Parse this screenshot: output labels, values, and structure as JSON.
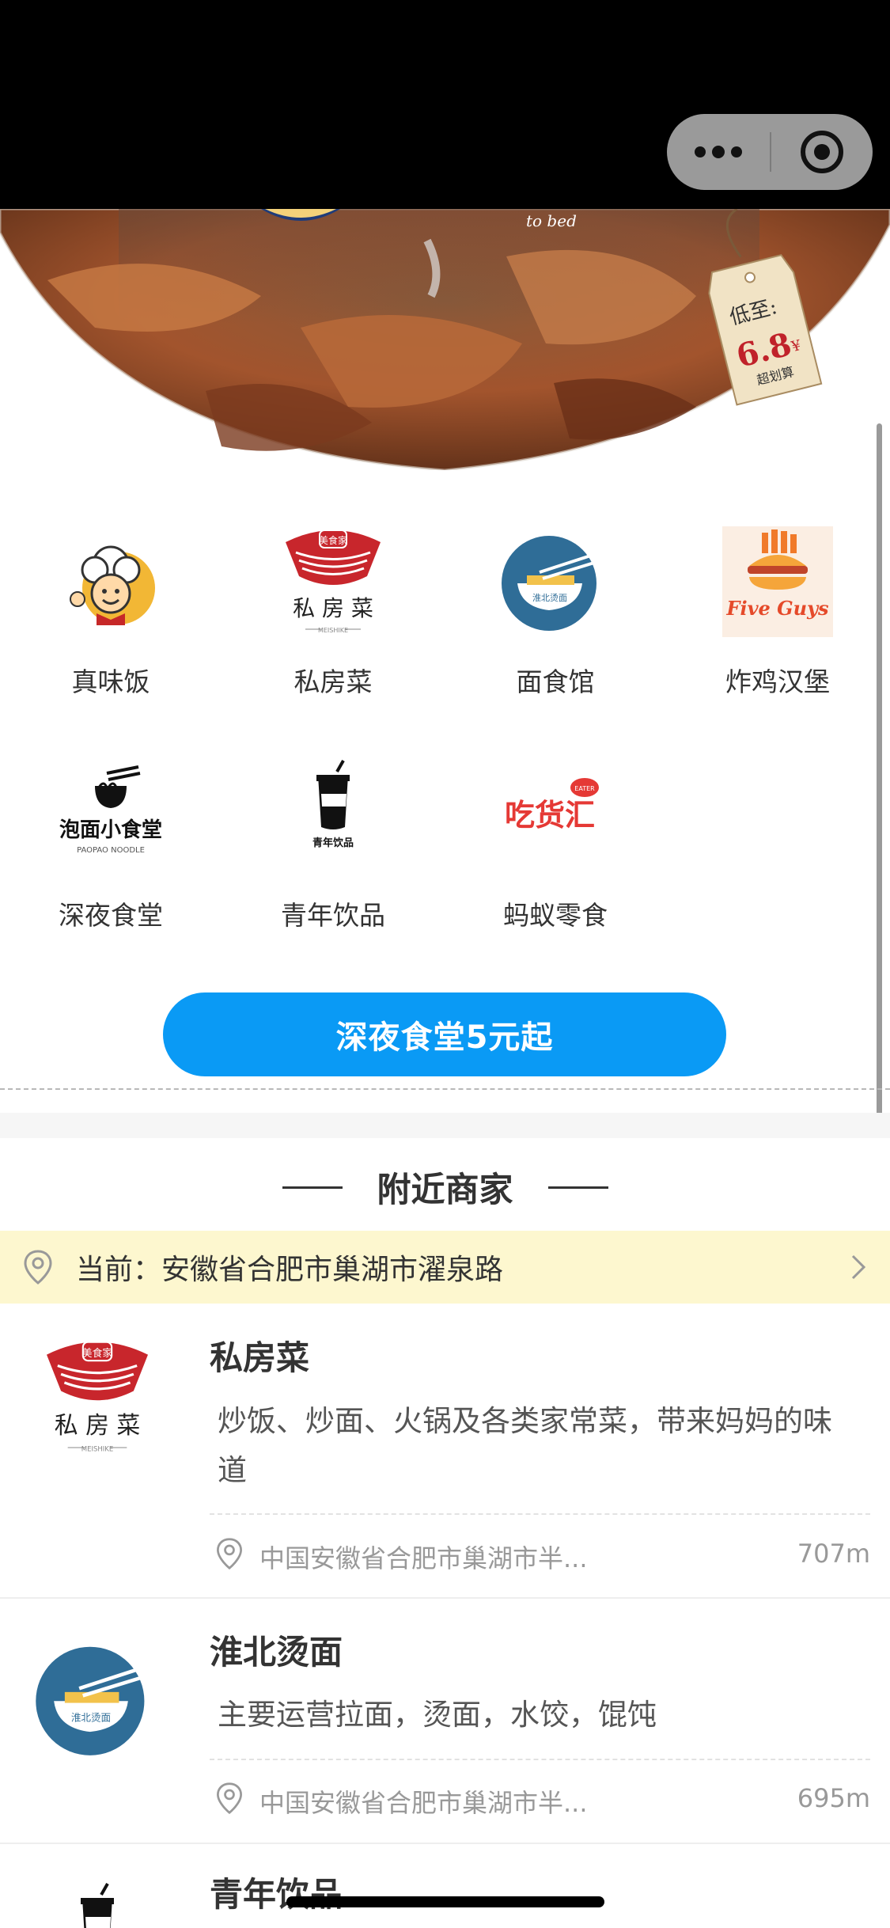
{
  "topbar": {
    "more_icon": "more-dots-icon",
    "target_icon": "target-icon"
  },
  "banner": {
    "caption": "to bed",
    "tag_title": "低至:",
    "tag_price": "6.8",
    "tag_unit": "¥",
    "tag_note": "超划算"
  },
  "categories": [
    {
      "label": "真味饭",
      "icon": "chef-mascot-icon"
    },
    {
      "label": "私房菜",
      "icon": "private-kitchen-logo"
    },
    {
      "label": "面食馆",
      "icon": "noodle-bowl-logo"
    },
    {
      "label": "炸鸡汉堡",
      "icon": "five-guys-burger-logo",
      "logo_text": "Five Guys"
    },
    {
      "label": "深夜食堂",
      "icon": "paopao-noodle-logo",
      "logo_text": "泡面小食堂",
      "logo_sub": "PAOPAO NOODLE"
    },
    {
      "label": "青年饮品",
      "icon": "drink-cup-logo",
      "logo_text": "青年饮品"
    },
    {
      "label": "蚂蚁零食",
      "icon": "snack-hub-logo",
      "logo_text": "吃货汇",
      "logo_sub": "EATER"
    }
  ],
  "cta": {
    "label": "深夜食堂5元起"
  },
  "nearby": {
    "title": "附近商家",
    "location_prefix": "当前：",
    "location": "安徽省合肥市巢湖市濯泉路",
    "shops": [
      {
        "name": "私房菜",
        "desc": "炒饭、炒面、火锅及各类家常菜，带来妈妈的味道",
        "address": "中国安徽省合肥市巢湖市半...",
        "distance": "707m",
        "logo": "private-kitchen-logo"
      },
      {
        "name": "淮北烫面",
        "desc": "主要运营拉面，烫面，水饺，馄饨",
        "address": "中国安徽省合肥市巢湖市半...",
        "distance": "695m",
        "logo": "noodle-bowl-logo"
      },
      {
        "name": "青年饮品",
        "logo": "drink-cup-logo"
      }
    ]
  },
  "logo_texts": {
    "private_kitchen_top": "美食家",
    "private_kitchen_main": "私 房 菜",
    "private_kitchen_sub": "MEISHIKE",
    "noodle_bowl": "淮北烫面"
  },
  "colors": {
    "accent": "#0a9af5",
    "location_bar": "#fdf7cf",
    "private_kitchen_red": "#c8262c",
    "noodle_blue": "#2f6d97"
  }
}
